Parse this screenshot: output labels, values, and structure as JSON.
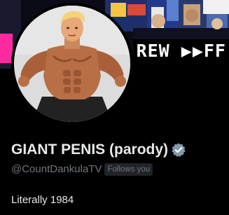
{
  "banner": {
    "text": "REW ▶▶FF"
  },
  "profile": {
    "display_name": "GIANT PENIS (parody)",
    "handle": "@CountDankulaTV",
    "follows_you_label": "Follows you",
    "bio": "Literally 1984"
  },
  "colors": {
    "background": "#000000",
    "primary_text": "#e7e9ea",
    "secondary_text": "#71767b",
    "badge_bg": "#202327",
    "banner_accent": "#ff2aa0"
  },
  "icons": {
    "verified": "verified-badge-icon"
  }
}
